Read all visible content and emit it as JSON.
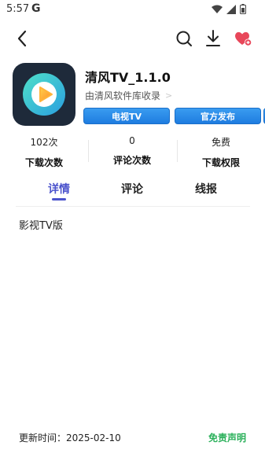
{
  "status_bar": {
    "time": "5:57",
    "g_label": "G",
    "icons": [
      "wifi-icon",
      "signal-icon",
      "battery-icon"
    ]
  },
  "top_bar": {
    "icons": [
      "back-icon",
      "search-icon",
      "download-icon",
      "heart-plus-icon"
    ]
  },
  "app": {
    "name": "清风TV_1.1.0",
    "source": "由清风软件库收录",
    "tags": [
      "电视TV",
      "官方发布",
      ""
    ]
  },
  "stats": [
    {
      "value": "102次",
      "label": "下载次数"
    },
    {
      "value": "0",
      "label": "评论次数"
    },
    {
      "value": "免费",
      "label": "下载权限"
    }
  ],
  "tabs": [
    {
      "label": "详情",
      "active": true
    },
    {
      "label": "评论",
      "active": false
    },
    {
      "label": "线报",
      "active": false
    }
  ],
  "detail": {
    "description": "影视TV版"
  },
  "footer": {
    "update_time": "更新时间：2025-02-10",
    "disclaimer": "免责声明"
  },
  "colors": {
    "accent": "#4a52cc",
    "tag_blue": "#1e7ce0",
    "green": "#2ab05a",
    "heart": "#e8475a"
  }
}
